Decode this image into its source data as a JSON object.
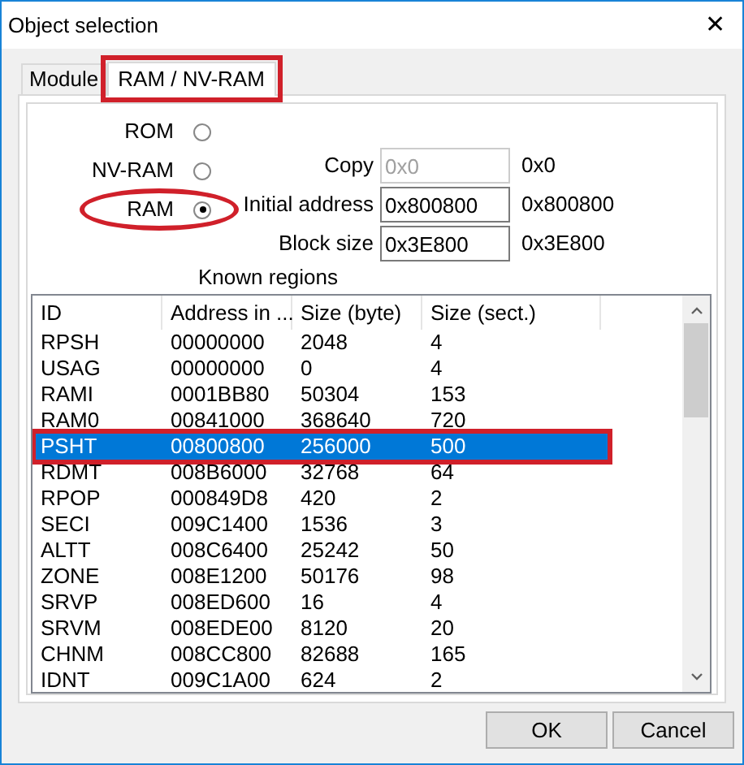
{
  "window": {
    "title": "Object selection",
    "close": "✕"
  },
  "tabs": [
    {
      "label": "Module",
      "selected": false,
      "highlighted": false
    },
    {
      "label": "RAM / NV-RAM",
      "selected": true,
      "highlighted": true
    }
  ],
  "memory_types": [
    {
      "label": "ROM",
      "selected": false,
      "highlighted": false
    },
    {
      "label": "NV-RAM",
      "selected": false,
      "highlighted": false
    },
    {
      "label": "RAM",
      "selected": true,
      "highlighted": true
    }
  ],
  "fields": [
    {
      "label": "Copy",
      "value": "0x0",
      "disabled": true,
      "reading": "0x0"
    },
    {
      "label": "Initial address",
      "value": "0x800800",
      "disabled": false,
      "reading": "0x800800"
    },
    {
      "label": "Block size",
      "value": "0x3E800",
      "disabled": false,
      "reading": "0x3E800"
    }
  ],
  "known_regions": {
    "title": "Known regions",
    "columns": [
      "ID",
      "Address in ...",
      "Size (byte)",
      "Size (sect.)"
    ],
    "rows": [
      {
        "cells": [
          "RPSH",
          "00000000",
          "2048",
          "4"
        ],
        "selected": false,
        "highlighted": false
      },
      {
        "cells": [
          "USAG",
          "00000000",
          "0",
          "4"
        ],
        "selected": false,
        "highlighted": false
      },
      {
        "cells": [
          "RAMI",
          "0001BB80",
          "50304",
          "153"
        ],
        "selected": false,
        "highlighted": false
      },
      {
        "cells": [
          "RAM0",
          "00841000",
          "368640",
          "720"
        ],
        "selected": false,
        "highlighted": false
      },
      {
        "cells": [
          "PSHT",
          "00800800",
          "256000",
          "500"
        ],
        "selected": true,
        "highlighted": true
      },
      {
        "cells": [
          "RDMT",
          "008B6000",
          "32768",
          "64"
        ],
        "selected": false,
        "highlighted": false
      },
      {
        "cells": [
          "RPOP",
          "000849D8",
          "420",
          "2"
        ],
        "selected": false,
        "highlighted": false
      },
      {
        "cells": [
          "SECI",
          "009C1400",
          "1536",
          "3"
        ],
        "selected": false,
        "highlighted": false
      },
      {
        "cells": [
          "ALTT",
          "008C6400",
          "25242",
          "50"
        ],
        "selected": false,
        "highlighted": false
      },
      {
        "cells": [
          "ZONE",
          "008E1200",
          "50176",
          "98"
        ],
        "selected": false,
        "highlighted": false
      },
      {
        "cells": [
          "SRVP",
          "008ED600",
          "16",
          "4"
        ],
        "selected": false,
        "highlighted": false
      },
      {
        "cells": [
          "SRVM",
          "008EDE00",
          "8120",
          "20"
        ],
        "selected": false,
        "highlighted": false
      },
      {
        "cells": [
          "CHNM",
          "008CC800",
          "82688",
          "165"
        ],
        "selected": false,
        "highlighted": false
      },
      {
        "cells": [
          "IDNT",
          "009C1A00",
          "624",
          "2"
        ],
        "selected": false,
        "highlighted": false
      }
    ]
  },
  "buttons": [
    "OK",
    "Cancel"
  ]
}
